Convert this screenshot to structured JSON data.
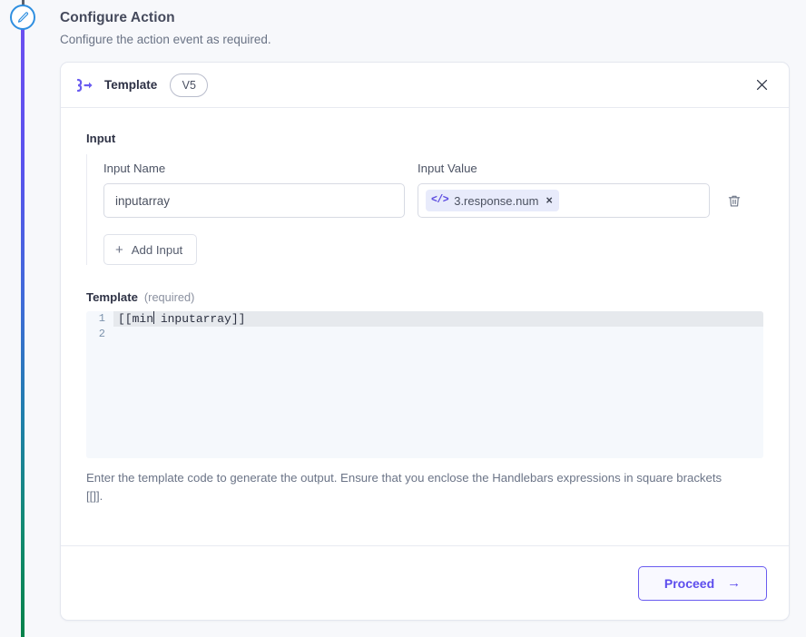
{
  "page": {
    "title": "Configure Action",
    "subtitle": "Configure the action event as required."
  },
  "timeline": {
    "step_icon": "pencil-icon",
    "line_gradient_start": "#6c4ff0",
    "line_gradient_end": "#06824a",
    "node_border_color": "#2f8fe0"
  },
  "card": {
    "icon": "template-arrow-icon",
    "title": "Template",
    "version_badge": "V5",
    "close_icon": "close-icon",
    "accent_color": "#5d4ded"
  },
  "input_section": {
    "label": "Input",
    "name_caption": "Input Name",
    "value_caption": "Input Value",
    "name_value": "inputarray",
    "name_placeholder": "Input Name",
    "token": {
      "icon": "code-icon",
      "icon_glyph": "</>",
      "text": "3.response.num",
      "remove_icon": "close-icon",
      "remove_glyph": "×",
      "background": "#e8ebfb"
    },
    "delete_row_icon": "trash-icon",
    "add_input_label": "Add Input",
    "add_input_icon": "plus-icon",
    "add_input_glyph": "+"
  },
  "template_section": {
    "label": "Template",
    "required_hint": "(required)",
    "code_lines": [
      {
        "number": "1",
        "before_caret": "[[min",
        "after_caret": " inputarray]]",
        "active": true
      },
      {
        "number": "2",
        "before_caret": "",
        "after_caret": "",
        "active": false
      }
    ],
    "line_numbers": [
      "1",
      "2"
    ],
    "code_text": "[[min inputarray]]",
    "helper_text": "Enter the template code to generate the output. Ensure that you enclose the Handlebars expressions in square brackets [[]]."
  },
  "footer": {
    "proceed_label": "Proceed",
    "proceed_arrow": "→",
    "proceed_icon": "arrow-right-icon"
  }
}
